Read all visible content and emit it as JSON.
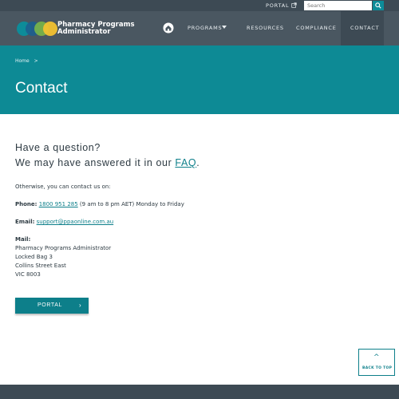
{
  "topbar": {
    "portal_label": "PORTAL",
    "search_placeholder": "Search"
  },
  "brand": {
    "line1": "Pharmacy Programs",
    "line2": "Administrator",
    "logo_colors": [
      "#0d8c99",
      "#1d5f8f",
      "#7ab648",
      "#f2c230"
    ]
  },
  "nav": {
    "items": [
      {
        "label": "PROGRAMS"
      },
      {
        "label": "RESOURCES"
      },
      {
        "label": "COMPLIANCE"
      },
      {
        "label": "CONTACT"
      }
    ]
  },
  "breadcrumb": {
    "home": "Home",
    "separator": ">"
  },
  "page": {
    "title": "Contact"
  },
  "content": {
    "question_line1": "Have a question?",
    "question_line2_prefix": "We may have answered it in our ",
    "question_line2_link": "FAQ",
    "question_line2_suffix": ".",
    "otherwise": "Otherwise, you can contact us on:",
    "phone_label": "Phone:",
    "phone_number": "1800 951 285",
    "phone_hours": " (9 am to 8 pm AET) Monday to Friday",
    "email_label": "Email:",
    "email_address": "support@ppaonline.com.au",
    "mail_label": "Mail:",
    "mail_lines": [
      "Pharmacy Programs Administrator",
      "Locked Bag 3",
      "Collins Street East",
      "VIC 8003"
    ]
  },
  "portal_button": {
    "label": "PORTAL",
    "chevron": "›"
  },
  "back_to_top": {
    "arrow": "^",
    "label": "BACK TO TOP"
  },
  "colors": {
    "teal": "#0d8a95",
    "nav_bg": "#4a5761",
    "topbar_bg": "#3d4a54"
  }
}
